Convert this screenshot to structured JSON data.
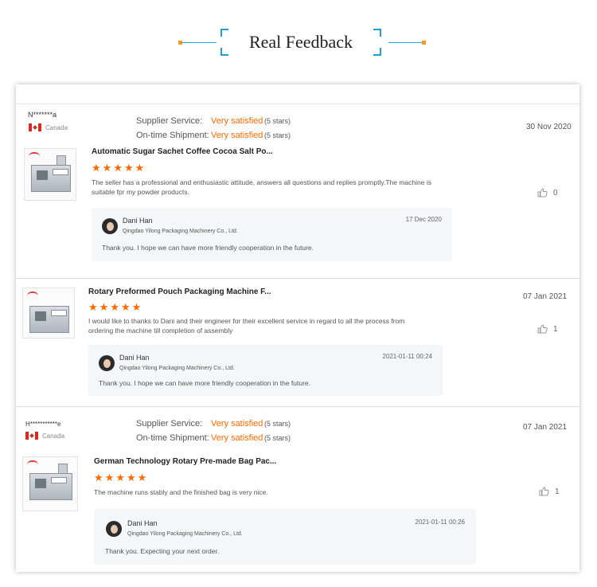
{
  "header": {
    "title": "Real Feedback"
  },
  "reviews": [
    {
      "buyer": "N*******a",
      "country": "Canada",
      "supplier_service_label": "Supplier Service:",
      "supplier_service_value": "Very satisfied",
      "supplier_service_stars": "(5 stars)",
      "ontime_label": "On-time Shipment:",
      "ontime_value": "Very satisfied",
      "ontime_stars": "(5 stars)",
      "date": "30 Nov 2020",
      "product_title": "Automatic Sugar Sachet Coffee Cocoa Salt Po...",
      "rating": 5,
      "comment": "The seller has a professional and enthusiastic attitude, answers all questions and replies promptly.The machine is suitable fpr my powder products.",
      "likes": "0",
      "reply": {
        "name": "Dani Han",
        "company": "Qingdao Yilong Packaging Machinery Co., Ltd.",
        "date": "17 Dec 2020",
        "text": "Thank you. I hope we can have more friendly cooperation in the future."
      }
    },
    {
      "date": "07 Jan 2021",
      "product_title": "Rotary Preformed Pouch Packaging Machine F...",
      "rating": 5,
      "comment": "I would like to thanks to Dani and their engineer for their excellent service in regard to all the process from ordering the machine till completion of assembly",
      "likes": "1",
      "reply": {
        "name": "Dani Han",
        "company": "Qingdao Yilong Packaging Machinery Co., Ltd.",
        "date": "2021-01-11 00:24",
        "text": "Thank you. I hope we can have more friendly cooperation in the future."
      }
    },
    {
      "buyer": "H***********e",
      "country": "Canada",
      "supplier_service_label": "Supplier Service:",
      "supplier_service_value": "Very satisfied",
      "supplier_service_stars": "(5 stars)",
      "ontime_label": "On-time Shipment:",
      "ontime_value": "Very satisfied",
      "ontime_stars": "(5 stars)",
      "date": "07 Jan 2021",
      "product_title": "German Technology Rotary Pre-made Bag Pac...",
      "rating": 5,
      "comment": "The machine runs stably and the finished bag is very nice.",
      "likes": "1",
      "reply": {
        "name": "Dani Han",
        "company": "Qingdao Yilong Packaging Machinery Co., Ltd.",
        "date": "2021-01-11 00:26",
        "text": "Thank you. Expecting your next order."
      }
    }
  ],
  "colors": {
    "accent_orange": "#ff6a00",
    "header_blue": "#1fa3d6",
    "header_dot": "#f39a1f"
  },
  "icons": {
    "like": "thumbs-up-icon",
    "star": "star-icon",
    "flag": "canada-flag-icon"
  }
}
